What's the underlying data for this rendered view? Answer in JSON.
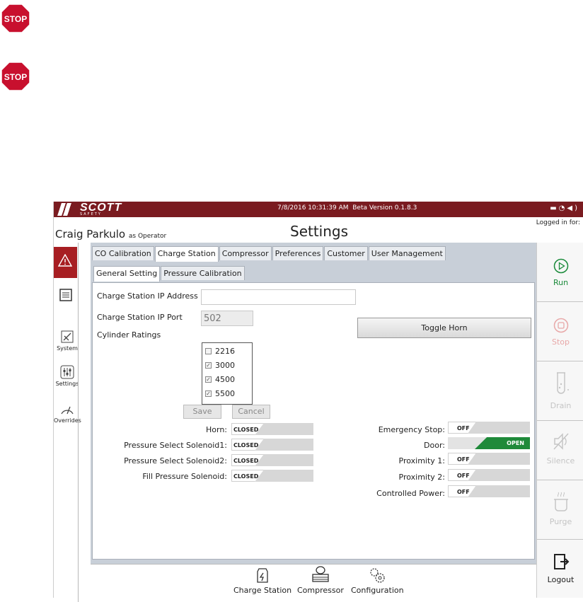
{
  "stop_signs": [
    {
      "text": "STOP"
    },
    {
      "text": "STOP"
    }
  ],
  "titlebar": {
    "logo_word": "SCOTT",
    "logo_sub": "SAFETY",
    "datetime": "7/8/2016 10:31:39 AM",
    "version": "Beta Version 0.1.8.3",
    "status_icons": [
      "battery-icon",
      "wifi-icon",
      "speaker-icon"
    ]
  },
  "header": {
    "user": "Craig Parkulo",
    "role": "as Operator",
    "title": "Settings",
    "logged_in": "Logged in for:"
  },
  "leftnav": {
    "items": [
      {
        "label": "System"
      },
      {
        "label": "Settings"
      },
      {
        "label": "Overrides"
      }
    ]
  },
  "tabs": [
    "CO Calibration",
    "Charge Station",
    "Compressor",
    "Preferences",
    "Customer",
    "User Management"
  ],
  "active_tab": "Charge Station",
  "subtabs": [
    "General Setting",
    "Pressure Calibration"
  ],
  "active_subtab": "General Setting",
  "form": {
    "ip_label": "Charge Station IP Address",
    "ip_value": "",
    "port_label": "Charge Station IP Port",
    "port_value": "502",
    "cyl_label": "Cylinder Ratings",
    "cylinders": [
      {
        "value": "2216",
        "checked": false
      },
      {
        "value": "3000",
        "checked": true
      },
      {
        "value": "4500",
        "checked": true
      },
      {
        "value": "5500",
        "checked": true
      }
    ],
    "save": "Save",
    "cancel": "Cancel",
    "toggle_horn": "Toggle Horn"
  },
  "status_left": [
    {
      "label": "Horn:",
      "state": "CLOSED"
    },
    {
      "label": "Pressure Select Solenoid1:",
      "state": "CLOSED"
    },
    {
      "label": "Pressure Select Solenoid2:",
      "state": "CLOSED"
    },
    {
      "label": "Fill Pressure Solenoid:",
      "state": "CLOSED"
    }
  ],
  "status_right": [
    {
      "label": "Emergency Stop:",
      "state": "OFF"
    },
    {
      "label": "Door:",
      "state": "OPEN"
    },
    {
      "label": "Proximity 1:",
      "state": "OFF"
    },
    {
      "label": "Proximity 2:",
      "state": "OFF"
    },
    {
      "label": "Controlled Power:",
      "state": "OFF"
    }
  ],
  "bottom_nav": [
    "Charge Station",
    "Compressor",
    "Configuration"
  ],
  "right_actions": [
    {
      "label": "Run",
      "enabled": true
    },
    {
      "label": "Stop",
      "enabled": false
    },
    {
      "label": "Drain",
      "enabled": false
    },
    {
      "label": "Silence",
      "enabled": false
    },
    {
      "label": "Purge",
      "enabled": false
    },
    {
      "label": "Logout",
      "enabled": true
    }
  ],
  "colors": {
    "titlebar": "#7a1b20",
    "alert": "#a71e22",
    "open_state": "#1f8a3a",
    "run": "#1a8a3a"
  }
}
